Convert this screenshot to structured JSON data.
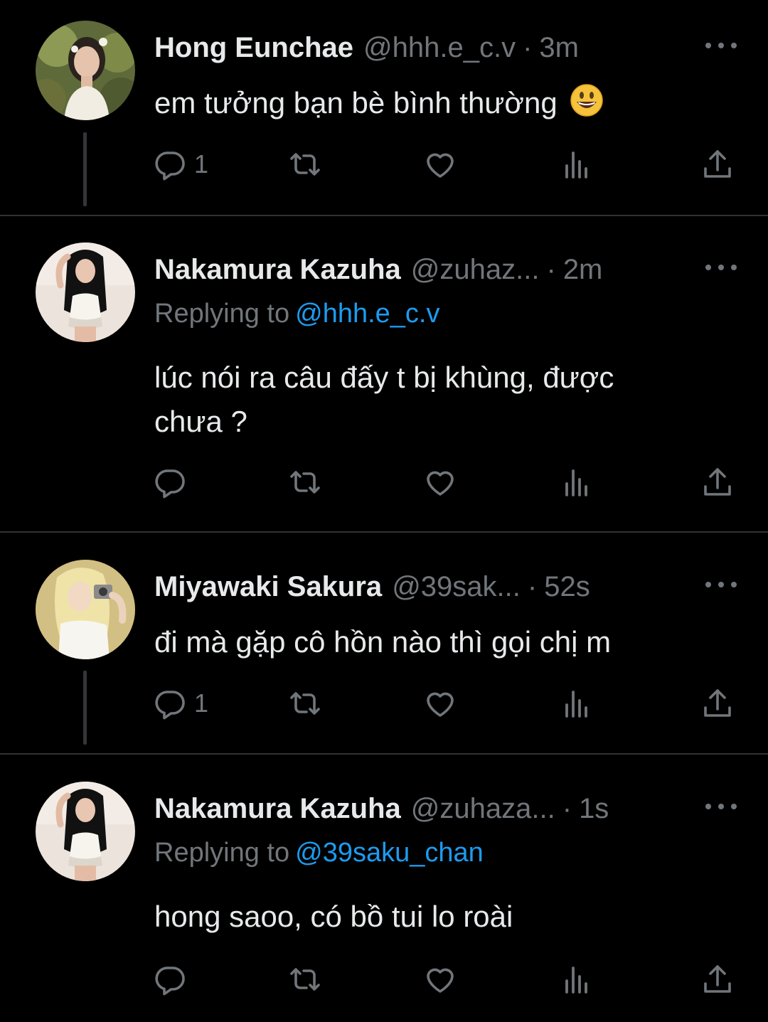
{
  "colors": {
    "background": "#000000",
    "text": "#e7e9ea",
    "muted": "#71767b",
    "link": "#1d9bf0",
    "divider": "#2f3336"
  },
  "icons": [
    "reply-icon",
    "retweet-icon",
    "like-icon",
    "views-icon",
    "share-icon",
    "more-icon"
  ],
  "tweets": [
    {
      "name": "Hong Eunchae",
      "handle": "@hhh.e_c.v",
      "separator": "·",
      "time": "3m",
      "reply_prefix": "",
      "reply_to": "",
      "text": "em tưởng bạn bè bình thường",
      "emoji": "grinning-face-emoji",
      "reply_count": "1"
    },
    {
      "name": "Nakamura Kazuha",
      "handle": "@zuhaz...",
      "separator": "·",
      "time": "2m",
      "reply_prefix": "Replying to",
      "reply_to": "@hhh.e_c.v",
      "text": "lúc nói ra câu đấy t bị khùng, được chưa ?",
      "reply_count": ""
    },
    {
      "name": "Miyawaki Sakura",
      "handle": "@39sak...",
      "separator": "·",
      "time": "52s",
      "reply_prefix": "",
      "reply_to": "",
      "text": "đi mà gặp cô hồn nào thì gọi chị m",
      "reply_count": "1"
    },
    {
      "name": "Nakamura Kazuha",
      "handle": "@zuhaza...",
      "separator": "·",
      "time": "1s",
      "reply_prefix": "Replying to",
      "reply_to": "@39saku_chan",
      "text": "hong saoo, có bồ tui lo roài",
      "reply_count": ""
    }
  ]
}
